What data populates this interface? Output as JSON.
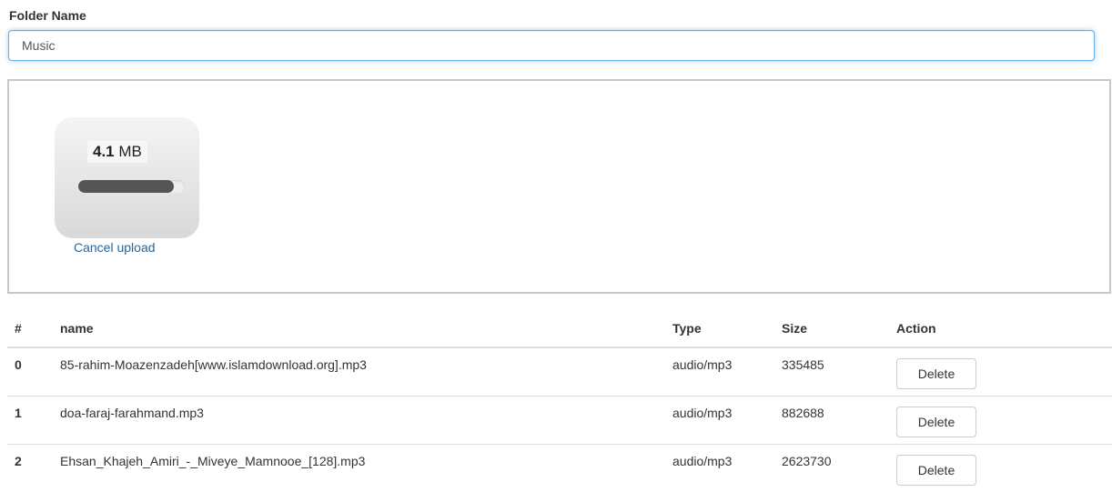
{
  "form": {
    "folder_label": "Folder Name",
    "folder_value": "Music"
  },
  "upload": {
    "size_value": "4.1",
    "size_unit": "MB",
    "progress_fraction": 0.9,
    "cancel_label": "Cancel upload"
  },
  "table": {
    "headers": [
      "#",
      "name",
      "Type",
      "Size",
      "Action"
    ],
    "delete_label": "Delete",
    "rows": [
      {
        "index": "0",
        "name": "85-rahim-Moazenzadeh[www.islamdownload.org].mp3",
        "type": "audio/mp3",
        "size": "335485"
      },
      {
        "index": "1",
        "name": "doa-faraj-farahmand.mp3",
        "type": "audio/mp3",
        "size": "882688"
      },
      {
        "index": "2",
        "name": "Ehsan_Khajeh_Amiri_-_Miveye_Mamnooe_[128].mp3",
        "type": "audio/mp3",
        "size": "2623730"
      }
    ]
  },
  "colors": {
    "link": "#2a6496",
    "focus_border": "#66afe9",
    "progress_fill": "#555555"
  }
}
